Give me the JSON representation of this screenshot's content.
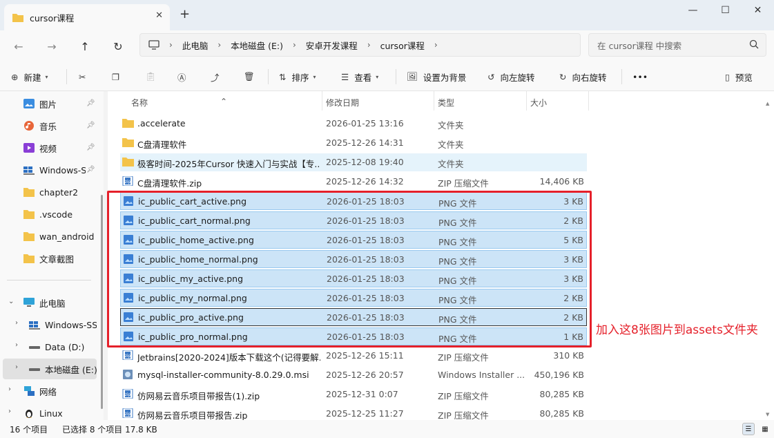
{
  "window": {
    "tab_title": "cursor课程",
    "close_tab": "✕",
    "new_tab": "+",
    "minimize": "—",
    "maximize": "☐",
    "close": "✕"
  },
  "nav": {
    "breadcrumbs": [
      "此电脑",
      "本地磁盘 (E:)",
      "安卓开发课程",
      "cursor课程"
    ],
    "search_placeholder": "在 cursor课程 中搜索"
  },
  "toolbar": {
    "new_label": "新建",
    "sort_label": "排序",
    "view_label": "查看",
    "set_bg_label": "设置为背景",
    "rotate_left_label": "向左旋转",
    "rotate_right_label": "向右旋转",
    "more_label": "•••",
    "preview_label": "预览"
  },
  "sidebar": {
    "quick": [
      {
        "label": "图片",
        "icon": "pictures-icon",
        "pinned": true
      },
      {
        "label": "音乐",
        "icon": "music-icon",
        "pinned": true
      },
      {
        "label": "视频",
        "icon": "videos-icon",
        "pinned": true
      },
      {
        "label": "Windows-SSD",
        "icon": "drive-icon",
        "pinned": true
      },
      {
        "label": "chapter2",
        "icon": "folder-icon"
      },
      {
        "label": ".vscode",
        "icon": "folder-icon"
      },
      {
        "label": "wan_android",
        "icon": "folder-icon"
      },
      {
        "label": "文章截图",
        "icon": "folder-icon"
      }
    ],
    "tree": [
      {
        "label": "此电脑",
        "icon": "this-pc-icon",
        "expanded": true
      },
      {
        "label": "Windows-SSD",
        "icon": "drive-icon"
      },
      {
        "label": "Data (D:)",
        "icon": "drive-icon"
      },
      {
        "label": "本地磁盘 (E:)",
        "icon": "drive-icon",
        "selected": true
      },
      {
        "label": "网络",
        "icon": "network-icon"
      },
      {
        "label": "Linux",
        "icon": "linux-icon"
      }
    ]
  },
  "columns": {
    "name": "名称",
    "date": "修改日期",
    "type": "类型",
    "size": "大小"
  },
  "files": [
    {
      "name": ".accelerate",
      "date": "2026-01-25 13:16",
      "type": "文件夹",
      "size": "",
      "kind": "folder"
    },
    {
      "name": "C盘清理软件",
      "date": "2025-12-26 14:31",
      "type": "文件夹",
      "size": "",
      "kind": "folder"
    },
    {
      "name": "极客时间-2025年Cursor 快速入门与实战【专...",
      "date": "2025-12-08 19:40",
      "type": "文件夹",
      "size": "",
      "kind": "folder",
      "hover": true
    },
    {
      "name": "C盘清理软件.zip",
      "date": "2025-12-26 14:32",
      "type": "ZIP 压缩文件",
      "size": "14,406 KB",
      "kind": "zip"
    },
    {
      "name": "ic_public_cart_active.png",
      "date": "2026-01-25 18:03",
      "type": "PNG 文件",
      "size": "3 KB",
      "kind": "png",
      "selected": true
    },
    {
      "name": "ic_public_cart_normal.png",
      "date": "2026-01-25 18:03",
      "type": "PNG 文件",
      "size": "2 KB",
      "kind": "png",
      "selected": true
    },
    {
      "name": "ic_public_home_active.png",
      "date": "2026-01-25 18:03",
      "type": "PNG 文件",
      "size": "5 KB",
      "kind": "png",
      "selected": true
    },
    {
      "name": "ic_public_home_normal.png",
      "date": "2026-01-25 18:03",
      "type": "PNG 文件",
      "size": "3 KB",
      "kind": "png",
      "selected": true
    },
    {
      "name": "ic_public_my_active.png",
      "date": "2026-01-25 18:03",
      "type": "PNG 文件",
      "size": "3 KB",
      "kind": "png",
      "selected": true
    },
    {
      "name": "ic_public_my_normal.png",
      "date": "2026-01-25 18:03",
      "type": "PNG 文件",
      "size": "2 KB",
      "kind": "png",
      "selected": true
    },
    {
      "name": "ic_public_pro_active.png",
      "date": "2026-01-25 18:03",
      "type": "PNG 文件",
      "size": "2 KB",
      "kind": "png",
      "selected": true,
      "focused": true
    },
    {
      "name": "ic_public_pro_normal.png",
      "date": "2026-01-25 18:03",
      "type": "PNG 文件",
      "size": "1 KB",
      "kind": "png",
      "selected": true
    },
    {
      "name": "Jetbrains[2020-2024]版本下载这个(记得要解...",
      "date": "2025-12-26 15:11",
      "type": "ZIP 压缩文件",
      "size": "310 KB",
      "kind": "zip"
    },
    {
      "name": "mysql-installer-community-8.0.29.0.msi",
      "date": "2025-12-26 20:57",
      "type": "Windows Installer ...",
      "size": "450,196 KB",
      "kind": "msi"
    },
    {
      "name": "仿网易云音乐项目带报告(1).zip",
      "date": "2025-12-31 0:07",
      "type": "ZIP 压缩文件",
      "size": "80,285 KB",
      "kind": "zip"
    },
    {
      "name": "仿网易云音乐项目带报告.zip",
      "date": "2025-12-25 11:27",
      "type": "ZIP 压缩文件",
      "size": "80,285 KB",
      "kind": "zip"
    }
  ],
  "annotation": "加入这8张图片到assets文件夹",
  "status": {
    "count": "16 个项目",
    "selected": "已选择 8 个项目  17.8 KB"
  },
  "colors": {
    "selection": "#cce4f7",
    "selection_border": "#99c9ef",
    "annotation_red": "#e5202a",
    "folder_yellow": "#f3c34a"
  }
}
